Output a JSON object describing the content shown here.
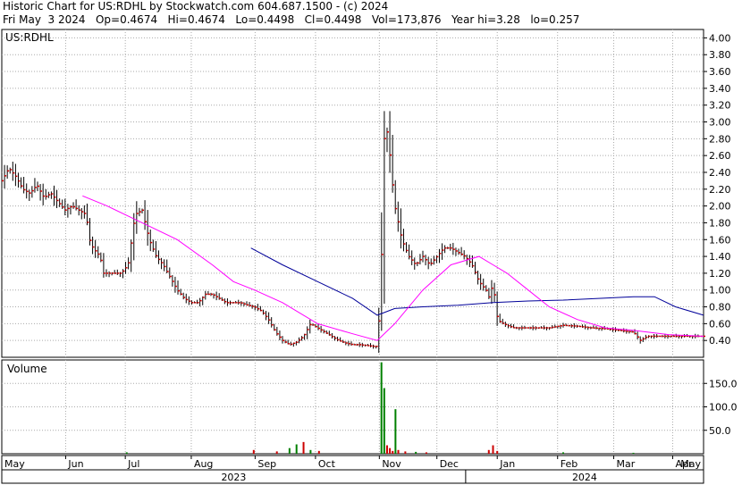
{
  "header": {
    "line1": "Historic Chart for US:RDHL by Stockwatch.com 604.687.1500 - (c) 2024",
    "line2": "Fri May  3 2024   Op=0.4674   Hi=0.4674   Lo=0.4498   Cl=0.4498   Vol=173,876   Year hi=3.28   lo=0.257"
  },
  "chart_data": {
    "type": "ohlc",
    "symbol_label": "US:RDHL",
    "price_axis": {
      "min": 0.2,
      "max": 4.1,
      "ticks": [
        "0.40",
        "0.60",
        "0.80",
        "1.00",
        "1.20",
        "1.40",
        "1.60",
        "1.80",
        "2.00",
        "2.20",
        "2.40",
        "2.60",
        "2.80",
        "3.00",
        "3.20",
        "3.40",
        "3.60",
        "3.80",
        "4.00"
      ]
    },
    "volume_panel": {
      "label": "Volume",
      "ticks": [
        "50.0",
        "100.0",
        "150.0"
      ],
      "max": 200,
      "bars": [
        {
          "x": 0.178,
          "v": 3,
          "color": "#008000"
        },
        {
          "x": 0.359,
          "v": 8,
          "color": "#cc0000"
        },
        {
          "x": 0.392,
          "v": 5,
          "color": "#cc0000"
        },
        {
          "x": 0.41,
          "v": 12,
          "color": "#008000"
        },
        {
          "x": 0.42,
          "v": 20,
          "color": "#008000"
        },
        {
          "x": 0.43,
          "v": 25,
          "color": "#cc0000"
        },
        {
          "x": 0.44,
          "v": 8,
          "color": "#008000"
        },
        {
          "x": 0.452,
          "v": 6,
          "color": "#cc0000"
        },
        {
          "x": 0.541,
          "v": 195,
          "color": "#008000"
        },
        {
          "x": 0.545,
          "v": 140,
          "color": "#008000"
        },
        {
          "x": 0.549,
          "v": 18,
          "color": "#cc0000"
        },
        {
          "x": 0.553,
          "v": 12,
          "color": "#cc0000"
        },
        {
          "x": 0.557,
          "v": 6,
          "color": "#cc0000"
        },
        {
          "x": 0.561,
          "v": 95,
          "color": "#008000"
        },
        {
          "x": 0.565,
          "v": 8,
          "color": "#cc0000"
        },
        {
          "x": 0.575,
          "v": 5,
          "color": "#cc0000"
        },
        {
          "x": 0.59,
          "v": 4,
          "color": "#008000"
        },
        {
          "x": 0.605,
          "v": 3,
          "color": "#cc0000"
        },
        {
          "x": 0.694,
          "v": 8,
          "color": "#cc0000"
        },
        {
          "x": 0.7,
          "v": 18,
          "color": "#cc0000"
        },
        {
          "x": 0.706,
          "v": 6,
          "color": "#cc0000"
        },
        {
          "x": 0.8,
          "v": 3,
          "color": "#008000"
        },
        {
          "x": 0.9,
          "v": 2,
          "color": "#008000"
        }
      ]
    },
    "price_path": [
      [
        0.0,
        2.3
      ],
      [
        0.01,
        2.45
      ],
      [
        0.02,
        2.35
      ],
      [
        0.03,
        2.2
      ],
      [
        0.04,
        2.15
      ],
      [
        0.05,
        2.25
      ],
      [
        0.06,
        2.1
      ],
      [
        0.07,
        2.15
      ],
      [
        0.08,
        2.05
      ],
      [
        0.09,
        1.95
      ],
      [
        0.1,
        2.0
      ],
      [
        0.11,
        1.95
      ],
      [
        0.12,
        1.9
      ],
      [
        0.125,
        1.6
      ],
      [
        0.13,
        1.5
      ],
      [
        0.14,
        1.4
      ],
      [
        0.145,
        1.2
      ],
      [
        0.16,
        1.2
      ],
      [
        0.17,
        1.2
      ],
      [
        0.18,
        1.3
      ],
      [
        0.19,
        1.9
      ],
      [
        0.2,
        1.95
      ],
      [
        0.21,
        1.6
      ],
      [
        0.22,
        1.4
      ],
      [
        0.23,
        1.3
      ],
      [
        0.24,
        1.15
      ],
      [
        0.25,
        1.0
      ],
      [
        0.26,
        0.9
      ],
      [
        0.27,
        0.85
      ],
      [
        0.28,
        0.85
      ],
      [
        0.29,
        0.95
      ],
      [
        0.3,
        0.95
      ],
      [
        0.31,
        0.9
      ],
      [
        0.32,
        0.85
      ],
      [
        0.33,
        0.85
      ],
      [
        0.34,
        0.85
      ],
      [
        0.35,
        0.82
      ],
      [
        0.36,
        0.8
      ],
      [
        0.37,
        0.75
      ],
      [
        0.38,
        0.65
      ],
      [
        0.39,
        0.5
      ],
      [
        0.4,
        0.4
      ],
      [
        0.41,
        0.35
      ],
      [
        0.42,
        0.38
      ],
      [
        0.43,
        0.45
      ],
      [
        0.44,
        0.6
      ],
      [
        0.45,
        0.55
      ],
      [
        0.46,
        0.5
      ],
      [
        0.47,
        0.45
      ],
      [
        0.48,
        0.4
      ],
      [
        0.49,
        0.37
      ],
      [
        0.5,
        0.35
      ],
      [
        0.51,
        0.35
      ],
      [
        0.52,
        0.34
      ],
      [
        0.53,
        0.33
      ],
      [
        0.535,
        0.33
      ],
      [
        0.54,
        1.0
      ],
      [
        0.545,
        2.8
      ],
      [
        0.55,
        2.9
      ],
      [
        0.555,
        2.4
      ],
      [
        0.56,
        2.0
      ],
      [
        0.565,
        1.8
      ],
      [
        0.57,
        1.6
      ],
      [
        0.58,
        1.4
      ],
      [
        0.59,
        1.3
      ],
      [
        0.6,
        1.4
      ],
      [
        0.61,
        1.3
      ],
      [
        0.62,
        1.4
      ],
      [
        0.63,
        1.5
      ],
      [
        0.64,
        1.5
      ],
      [
        0.65,
        1.45
      ],
      [
        0.66,
        1.4
      ],
      [
        0.67,
        1.3
      ],
      [
        0.68,
        1.1
      ],
      [
        0.69,
        1.0
      ],
      [
        0.695,
        0.9
      ],
      [
        0.7,
        1.1
      ],
      [
        0.705,
        0.7
      ],
      [
        0.71,
        0.62
      ],
      [
        0.72,
        0.58
      ],
      [
        0.73,
        0.55
      ],
      [
        0.74,
        0.55
      ],
      [
        0.76,
        0.55
      ],
      [
        0.78,
        0.55
      ],
      [
        0.8,
        0.58
      ],
      [
        0.82,
        0.57
      ],
      [
        0.84,
        0.55
      ],
      [
        0.86,
        0.54
      ],
      [
        0.88,
        0.52
      ],
      [
        0.9,
        0.5
      ],
      [
        0.91,
        0.4
      ],
      [
        0.92,
        0.45
      ],
      [
        0.94,
        0.45
      ],
      [
        0.96,
        0.45
      ],
      [
        0.98,
        0.45
      ],
      [
        1.0,
        0.45
      ]
    ],
    "ma_short": {
      "color": "#ff00ff",
      "points": [
        [
          0.115,
          2.12
        ],
        [
          0.15,
          2.0
        ],
        [
          0.2,
          1.8
        ],
        [
          0.25,
          1.6
        ],
        [
          0.3,
          1.3
        ],
        [
          0.33,
          1.1
        ],
        [
          0.36,
          1.0
        ],
        [
          0.4,
          0.85
        ],
        [
          0.45,
          0.6
        ],
        [
          0.5,
          0.48
        ],
        [
          0.535,
          0.4
        ],
        [
          0.56,
          0.6
        ],
        [
          0.6,
          1.0
        ],
        [
          0.64,
          1.3
        ],
        [
          0.68,
          1.4
        ],
        [
          0.7,
          1.3
        ],
        [
          0.72,
          1.2
        ],
        [
          0.75,
          1.0
        ],
        [
          0.78,
          0.8
        ],
        [
          0.82,
          0.65
        ],
        [
          0.86,
          0.55
        ],
        [
          0.9,
          0.52
        ],
        [
          0.95,
          0.47
        ],
        [
          1.0,
          0.45
        ]
      ]
    },
    "ma_long": {
      "color": "#000099",
      "points": [
        [
          0.355,
          1.5
        ],
        [
          0.4,
          1.3
        ],
        [
          0.45,
          1.1
        ],
        [
          0.5,
          0.9
        ],
        [
          0.535,
          0.7
        ],
        [
          0.56,
          0.78
        ],
        [
          0.6,
          0.8
        ],
        [
          0.65,
          0.82
        ],
        [
          0.7,
          0.85
        ],
        [
          0.75,
          0.87
        ],
        [
          0.8,
          0.88
        ],
        [
          0.85,
          0.9
        ],
        [
          0.9,
          0.92
        ],
        [
          0.93,
          0.92
        ],
        [
          0.96,
          0.8
        ],
        [
          1.0,
          0.7
        ]
      ]
    },
    "x_axis": {
      "months": [
        {
          "label": "May",
          "x": 0.0
        },
        {
          "label": "Jun",
          "x": 0.091
        },
        {
          "label": "Jul",
          "x": 0.176
        },
        {
          "label": "Aug",
          "x": 0.27
        },
        {
          "label": "Sep",
          "x": 0.361
        },
        {
          "label": "Oct",
          "x": 0.447
        },
        {
          "label": "Nov",
          "x": 0.538
        },
        {
          "label": "Dec",
          "x": 0.62
        },
        {
          "label": "Jan",
          "x": 0.706
        },
        {
          "label": "Feb",
          "x": 0.792
        },
        {
          "label": "Mar",
          "x": 0.872
        },
        {
          "label": "Apr",
          "x": 0.956
        },
        {
          "label": "May",
          "x": 1.0
        }
      ],
      "years": [
        {
          "label": "2023",
          "x0": 0.0,
          "x1": 0.661
        },
        {
          "label": "2024",
          "x0": 0.661,
          "x1": 1.0
        }
      ]
    }
  }
}
